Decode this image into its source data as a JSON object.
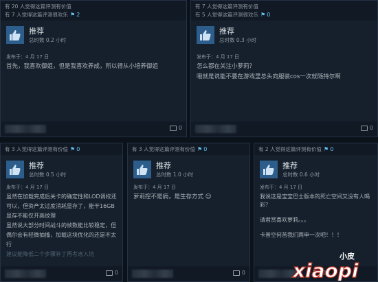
{
  "cards": [
    {
      "votes_helpful": "有 20 人觉得这篇评测有价值",
      "votes_funny": "有 7 人觉得这篇评测很欢乐",
      "funny_count": "2",
      "recommend": "推荐",
      "hours": "总时数 0.2 小时",
      "posted": "发布于：4 月 17 日",
      "lines": [
        "首先，我喜欢御姐，但是我喜欢养成，所以得从小培养御姐"
      ],
      "comments": "0"
    },
    {
      "votes_helpful": "有 7 人觉得这篇评测有价值",
      "votes_funny": "有 5 人觉得这篇评测很欢乐",
      "funny_count": "0",
      "recommend": "推荐",
      "hours": "总时数 0.3 小时",
      "posted": "发布于：4 月 17 日",
      "lines": [
        "怎么都在关注小萝莉？",
        "哦就是说能不要在游戏里总头向服装cos一次就随持尔啊"
      ],
      "comments": "0"
    },
    {
      "votes_helpful": "有 3 人觉得这篇评测有价值",
      "funny_count": "0",
      "recommend": "推荐",
      "hours": "总时数 0.5 小时",
      "posted": "发布于：4 月 17 日",
      "lines": [
        "虽然在加载完成后关卡的确定性和LOD调校还",
        "可以，但资产太过度消耗显存了，能干16GB",
        "显存不能仅开高纹理",
        "虽然说大部分时间战斗的帧数能比较稳定，但",
        "偶尔会有轻微抽搐，加载这块优化的还是不太",
        "行",
        "建议能降低二个步骤补了再考虑入坑"
      ],
      "comments": "0"
    },
    {
      "votes_helpful": "有 3 人觉得这篇评测有价值",
      "funny_count": "0",
      "recommend": "推荐",
      "hours": "总时数 1.0 小时",
      "posted": "发布于：4 月 17 日",
      "lines": [
        "萝莉控不是病，是生存方式 😊"
      ],
      "comments": "0"
    },
    {
      "votes_helpful": "有 2 人觉得这篇评测有价值",
      "funny_count": "0",
      "recommend": "推荐",
      "hours": "总时数 0.6 小时",
      "posted": "发布于：4 月 17 日",
      "lines": [
        "我说这是宝宝巴士版本的死亡空间又没有人喝彩？",
        "",
        "请君赏喜欢萝莉。。。",
        "",
        "卡普空何苦我们两申一次吧！！！"
      ],
      "comments": "0"
    }
  ],
  "watermark": "小皮 xiaopi"
}
